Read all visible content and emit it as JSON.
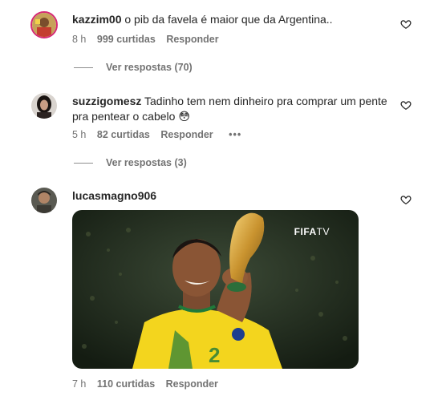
{
  "comments": [
    {
      "username": "kazzim00",
      "text": "o pib da favela é maior que da Argentina..",
      "time": "8 h",
      "likes": "999 curtidas",
      "reply": "Responder",
      "view_replies": "Ver respostas (70)",
      "icon": "heart-outline-icon"
    },
    {
      "username": "suzzigomesz",
      "text_line1": "Tadinho tem nem dinheiro pra comprar um pente",
      "text_line2": "pra pentear o cabelo 😳",
      "time": "5 h",
      "likes": "82 curtidas",
      "reply": "Responder",
      "more": "•••",
      "view_replies": "Ver respostas (3)",
      "icon": "heart-outline-icon"
    },
    {
      "username": "lucasmagno906",
      "time": "7 h",
      "likes": "110 curtidas",
      "reply": "Responder",
      "gif_brand": "FIFA",
      "gif_brand_suffix": "TV",
      "icon": "heart-outline-icon"
    }
  ],
  "colors": {
    "text": "#262626",
    "secondary": "#737373",
    "gif_bg": "#1e2a1c"
  }
}
